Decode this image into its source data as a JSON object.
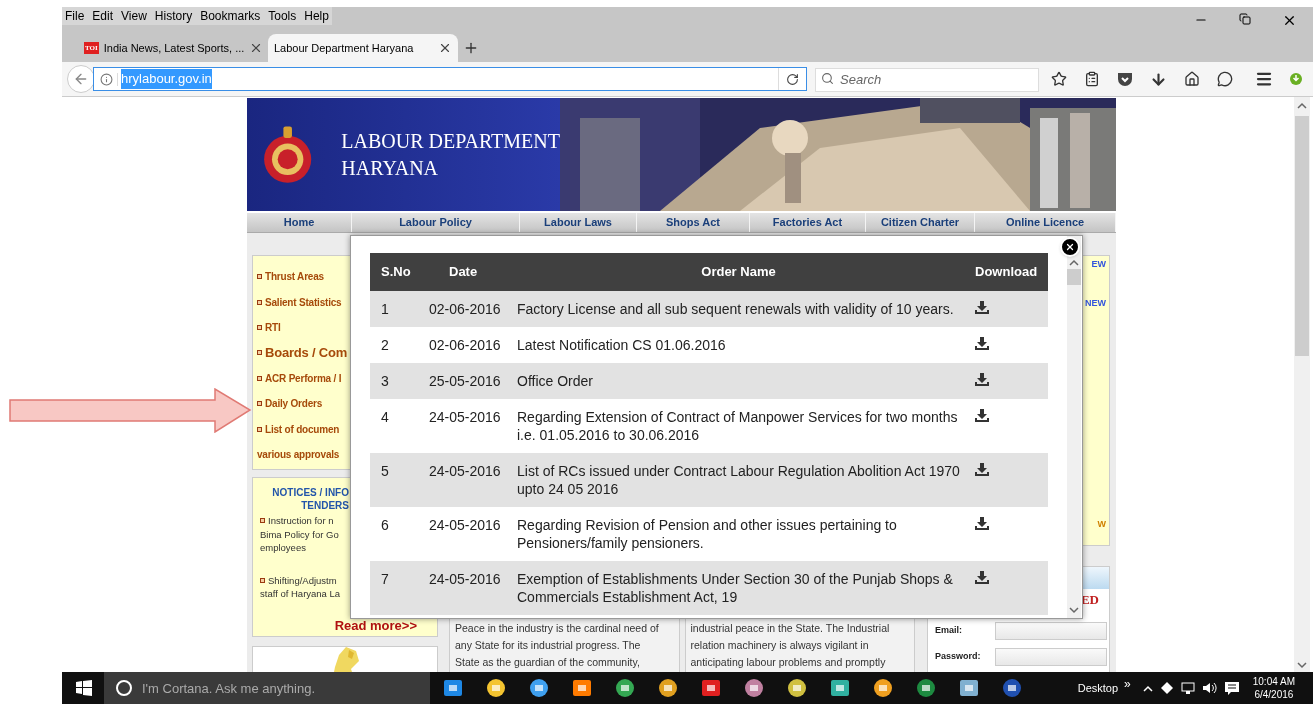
{
  "menu_bar": [
    "File",
    "Edit",
    "View",
    "History",
    "Bookmarks",
    "Tools",
    "Help"
  ],
  "tabs": [
    {
      "title": "India News, Latest Sports, ...",
      "favicon_text": "TOI",
      "selected": false
    },
    {
      "title": "Labour Department Haryana",
      "selected": true
    }
  ],
  "address_bar": {
    "url": "hrylabour.gov.in",
    "selected": true
  },
  "search": {
    "placeholder": "Search"
  },
  "site": {
    "title_lines": [
      "LABOUR DEPARTMENT",
      "HARYANA"
    ],
    "nav": [
      "Home",
      "Labour Policy",
      "Labour Laws",
      "Shops Act",
      "Factories Act",
      "Citizen Charter",
      "Online Licence"
    ],
    "sidebar_links": [
      {
        "label": "Thrust Areas",
        "kind": "link"
      },
      {
        "label": "Salient Statistics",
        "kind": "link"
      },
      {
        "label": "RTI",
        "kind": "link"
      },
      {
        "label": "Boards / Com",
        "kind": "large"
      },
      {
        "label": "ACR Performa / I",
        "kind": "link"
      },
      {
        "label": "Daily Orders",
        "kind": "link"
      },
      {
        "label": "List of documen",
        "kind": "link"
      },
      {
        "label": "various approvals",
        "kind": "continuation"
      }
    ],
    "notices": {
      "heading_lines": [
        "NOTICES / INFO",
        "TENDERS"
      ],
      "items": [
        [
          "Instruction for n",
          "Bima Policy for Go",
          "employees"
        ],
        [
          "Shifting/Adjustm",
          "staff of Haryana La"
        ]
      ],
      "read_more": "Read more>>"
    },
    "new_badges": [
      {
        "text": "EW",
        "color": "#3355dd"
      },
      {
        "text": "NEW",
        "color": "#3355dd"
      },
      {
        "text": "W",
        "color": "#d08000"
      }
    ],
    "intro_columns": [
      [
        "Peace in the industry is the cardinal need of",
        "any State for its industrial progress. The",
        "State as the guardian of the community,"
      ],
      [
        "industrial peace in the State. The Industrial",
        "relation machinery is always vigilant in",
        "anticipating labour problems and promptly"
      ]
    ],
    "login": {
      "heading_fragment": "ED",
      "fields": [
        "Email:",
        "Password:"
      ]
    }
  },
  "modal": {
    "columns": [
      "S.No",
      "Date",
      "Order Name",
      "Download"
    ],
    "rows": [
      {
        "sno": "1",
        "date": "02-06-2016",
        "name": "Factory License and all sub sequent renewals with validity of 10 years."
      },
      {
        "sno": "2",
        "date": "02-06-2016",
        "name": "Latest Notification CS 01.06.2016"
      },
      {
        "sno": "3",
        "date": "25-05-2016",
        "name": "Office Order"
      },
      {
        "sno": "4",
        "date": "24-05-2016",
        "name": "Regarding Extension of Contract of Manpower Services for two months i.e. 01.05.2016 to 30.06.2016"
      },
      {
        "sno": "5",
        "date": "24-05-2016",
        "name": "List of RCs issued under Contract Labour Regulation Abolition Act 1970 upto 24 05 2016"
      },
      {
        "sno": "6",
        "date": "24-05-2016",
        "name": "Regarding Revision of Pension and other issues pertaining to Pensioners/family pensioners."
      },
      {
        "sno": "7",
        "date": "24-05-2016",
        "name": "Exemption of Establishments Under Section 30 of the Punjab Shops & Commercials Establishment Act, 19"
      }
    ]
  },
  "taskbar": {
    "search_placeholder": "I'm Cortana. Ask me anything.",
    "desktop_label": "Desktop",
    "overflow": "»",
    "time": "10:04 AM",
    "date": "6/4/2016"
  }
}
